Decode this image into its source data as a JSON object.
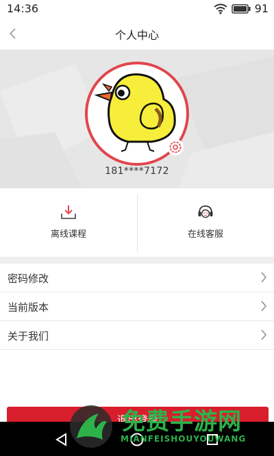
{
  "status_bar": {
    "time": "14:36",
    "battery": "91"
  },
  "nav": {
    "title": "个人中心"
  },
  "profile": {
    "phone": "181****7172"
  },
  "quick_actions": [
    {
      "label": "离线课程",
      "icon": "download-icon"
    },
    {
      "label": "在线客服",
      "icon": "headset-icon"
    }
  ],
  "menu": [
    {
      "label": "密码修改"
    },
    {
      "label": "当前版本"
    },
    {
      "label": "关于我们"
    }
  ],
  "logout": {
    "label": "退出登录"
  },
  "watermark": {
    "title": "免费手游网",
    "subtitle": "MIANFEISHOUYOUWANG"
  },
  "colors": {
    "accent": "#d81e2c",
    "watermark": "#2db24a"
  }
}
